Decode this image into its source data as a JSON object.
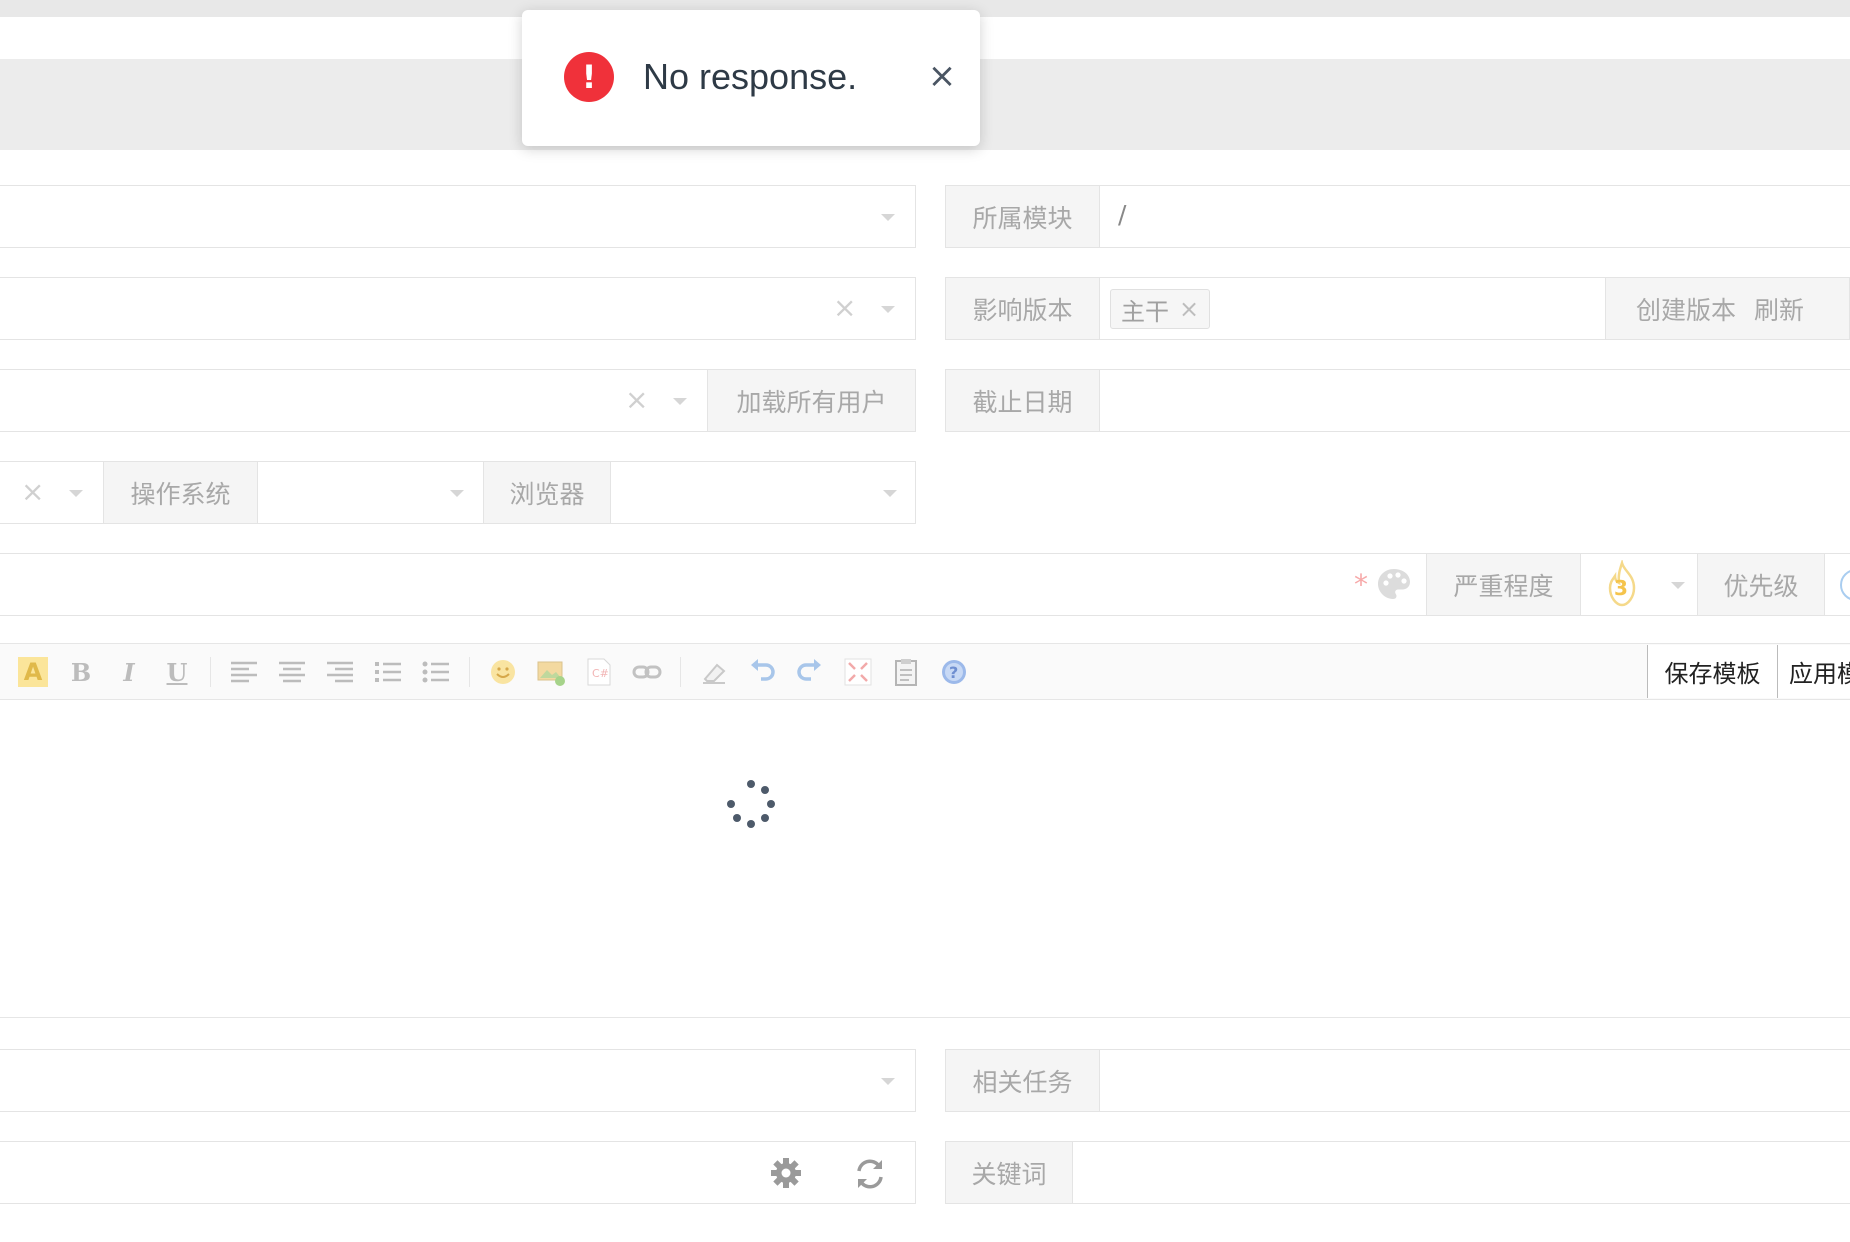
{
  "form": {
    "module": {
      "label": "所属模块",
      "value": "/"
    },
    "affected_build": {
      "label": "影响版本",
      "tag": "主干",
      "create_label": "创建版本",
      "refresh_label": "刷新"
    },
    "assign": {
      "load_all_label": "加载所有用户"
    },
    "deadline": {
      "label": "截止日期"
    },
    "os": {
      "label": "操作系统"
    },
    "browser": {
      "label": "浏览器"
    },
    "severity": {
      "label": "严重程度",
      "value": "3"
    },
    "priority": {
      "label": "优先级"
    },
    "related_task": {
      "label": "相关任务"
    },
    "keywords": {
      "label": "关键词"
    }
  },
  "editor": {
    "save_template_label": "保存模板",
    "apply_template_label": "应用模"
  },
  "toast": {
    "message": "No response.",
    "close_glyph": "×",
    "icon_glyph": "!"
  },
  "icons": {
    "required_mark": "*",
    "clear": "×"
  },
  "colors": {
    "error": "#f0313a",
    "severity": "#f5c44c",
    "spinner": "#4d5a6a"
  }
}
